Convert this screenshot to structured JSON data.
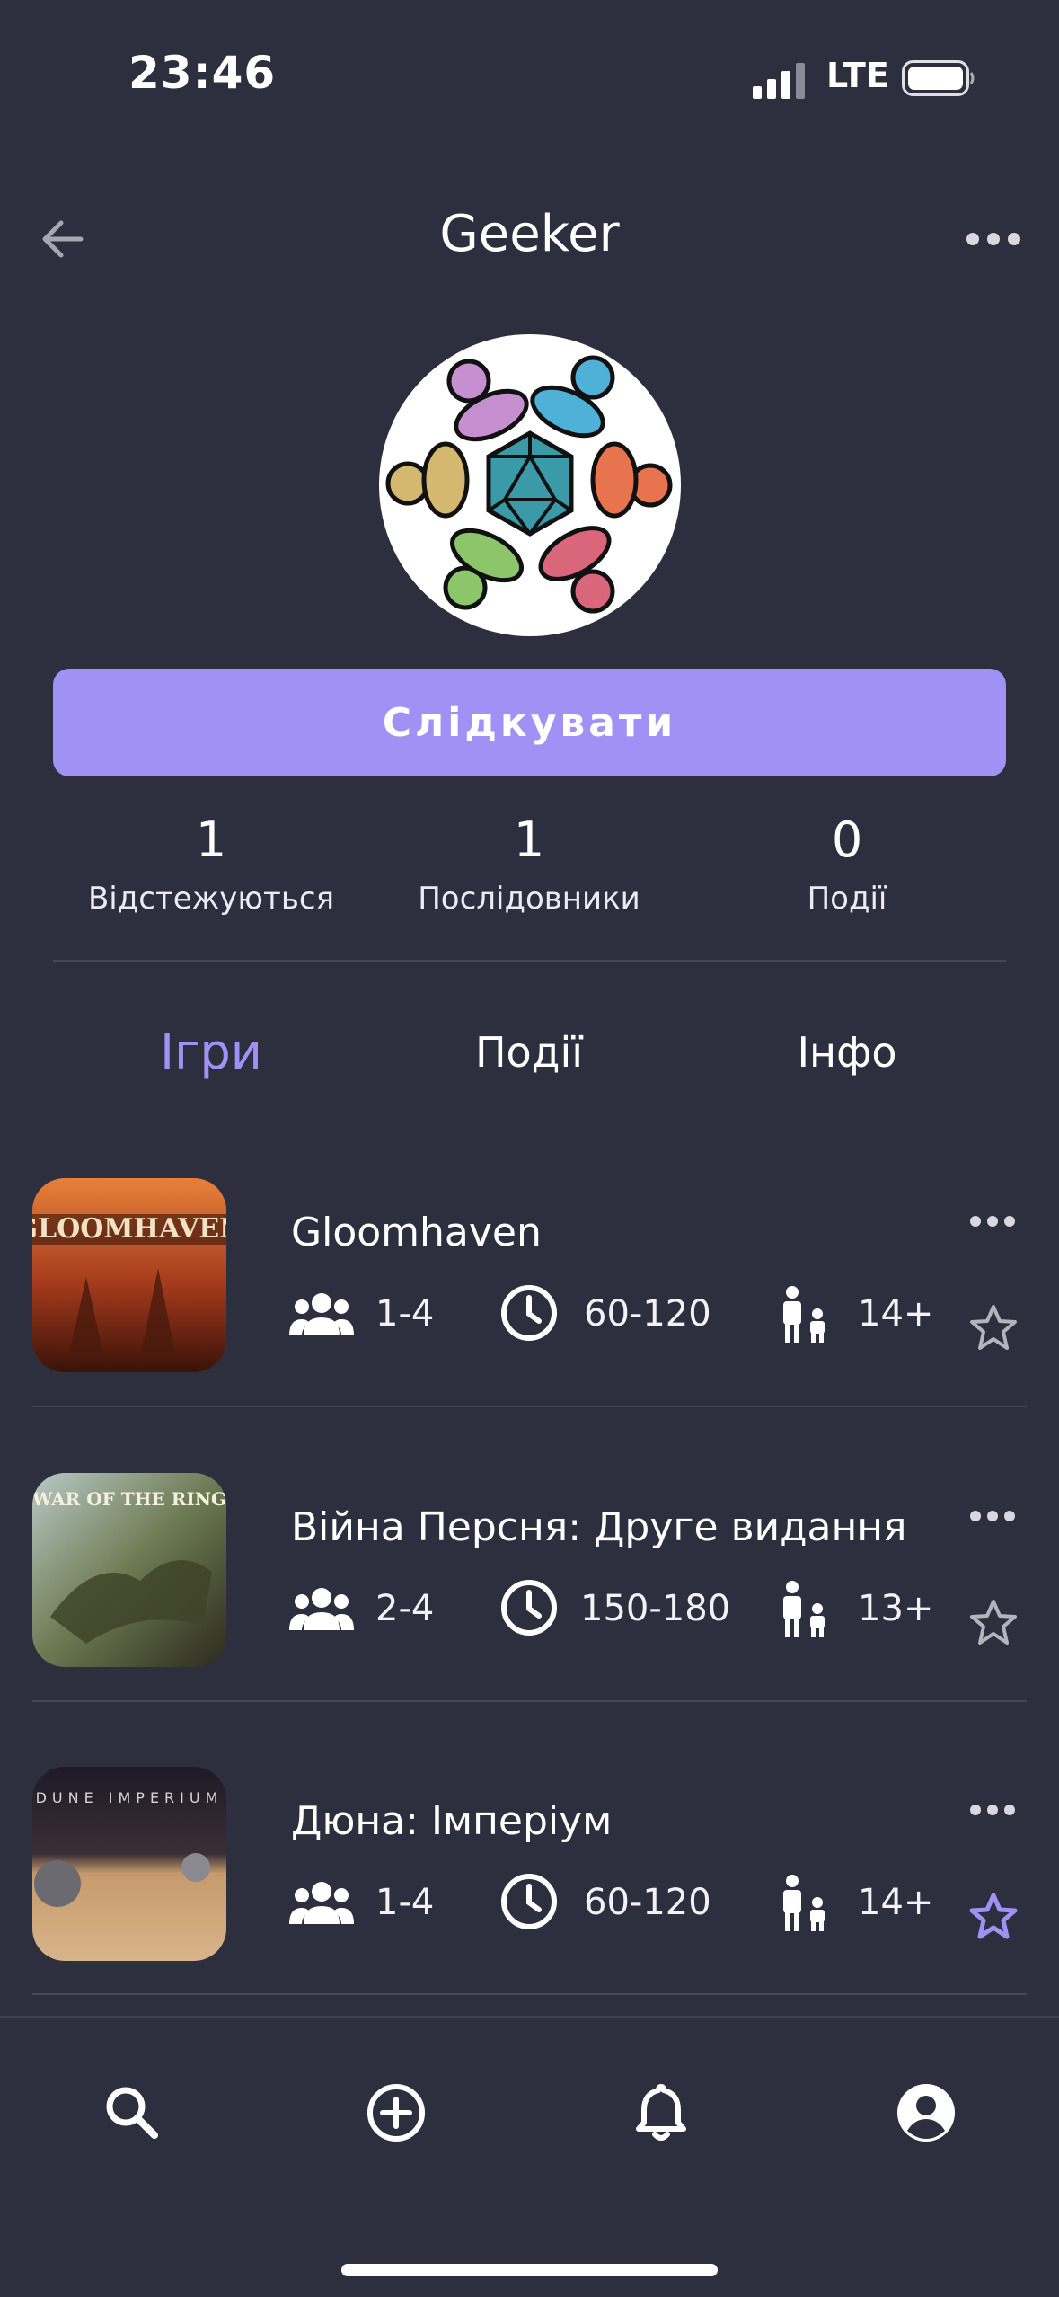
{
  "status_bar": {
    "time": "23:46",
    "network": "LTE"
  },
  "header": {
    "title": "Geeker",
    "back_icon": "arrow-left-icon",
    "more_icon": "more-horizontal-icon"
  },
  "profile": {
    "follow_label": "Слідкувати",
    "stats": [
      {
        "value": "1",
        "label": "Відстежуються"
      },
      {
        "value": "1",
        "label": "Послідовники"
      },
      {
        "value": "0",
        "label": "Події"
      }
    ]
  },
  "tabs": [
    {
      "label": "Ігри",
      "active": true
    },
    {
      "label": "Події",
      "active": false
    },
    {
      "label": "Інфо",
      "active": false
    }
  ],
  "games": [
    {
      "name": "Gloomhaven",
      "players": "1-4",
      "time": "60-120",
      "age": "14+",
      "favorite": false,
      "thumb_text": "GLOOMHAVEN"
    },
    {
      "name": "Війна Персня: Друге видання",
      "players": "2-4",
      "time": "150-180",
      "age": "13+",
      "favorite": false,
      "thumb_text": "WAR OF THE RING"
    },
    {
      "name": "Дюна: Імперіум",
      "players": "1-4",
      "time": "60-120",
      "age": "14+",
      "favorite": true,
      "thumb_text": "DUNE IMPERIUM"
    }
  ],
  "bottom_nav": [
    "search-icon",
    "add-circle-icon",
    "bell-icon",
    "account-icon"
  ],
  "colors": {
    "accent": "#a291f5",
    "background": "#2e2f3e",
    "divider": "#44465a"
  }
}
